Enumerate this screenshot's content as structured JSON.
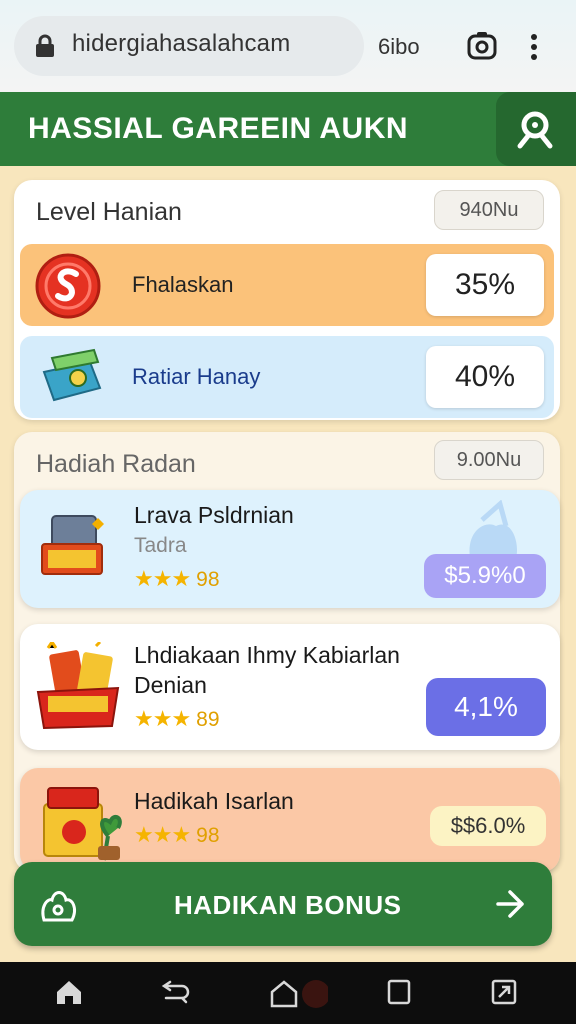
{
  "browser": {
    "url": "hidergiahasalahcam",
    "tabs_text": "6ibo"
  },
  "header": {
    "title": "HASSIAL GAREEIN AUKN"
  },
  "level": {
    "title": "Level Hanian",
    "badge": "940Nu",
    "rows": [
      {
        "label": "Fhalaskan",
        "value": "35%"
      },
      {
        "label": "Ratiar Hanay",
        "value": "40%"
      }
    ]
  },
  "rewards": {
    "title": "Hadiah Radan",
    "badge": "9.00Nu",
    "items": [
      {
        "title": "Lrava Psldrnian",
        "subtitle": "Tadra",
        "stars": "★★★",
        "rating": "98",
        "price": "$5.9%0"
      },
      {
        "title": "Lhdiakaan Ihmy Kabiarlan Denian",
        "stars": "★★★",
        "rating": "89",
        "price": "4,1%"
      },
      {
        "title": "Hadikah Isarlan",
        "stars": "★★★",
        "rating": "98",
        "price": "$$6.0%"
      }
    ]
  },
  "bonus": {
    "label": "HADIKAN BONUS"
  },
  "colors": {
    "header_green": "#2e7d3a",
    "row_orange": "#fbc27a",
    "row_blue": "#d5ecfb",
    "pill_purple": "#6b6fe6"
  }
}
